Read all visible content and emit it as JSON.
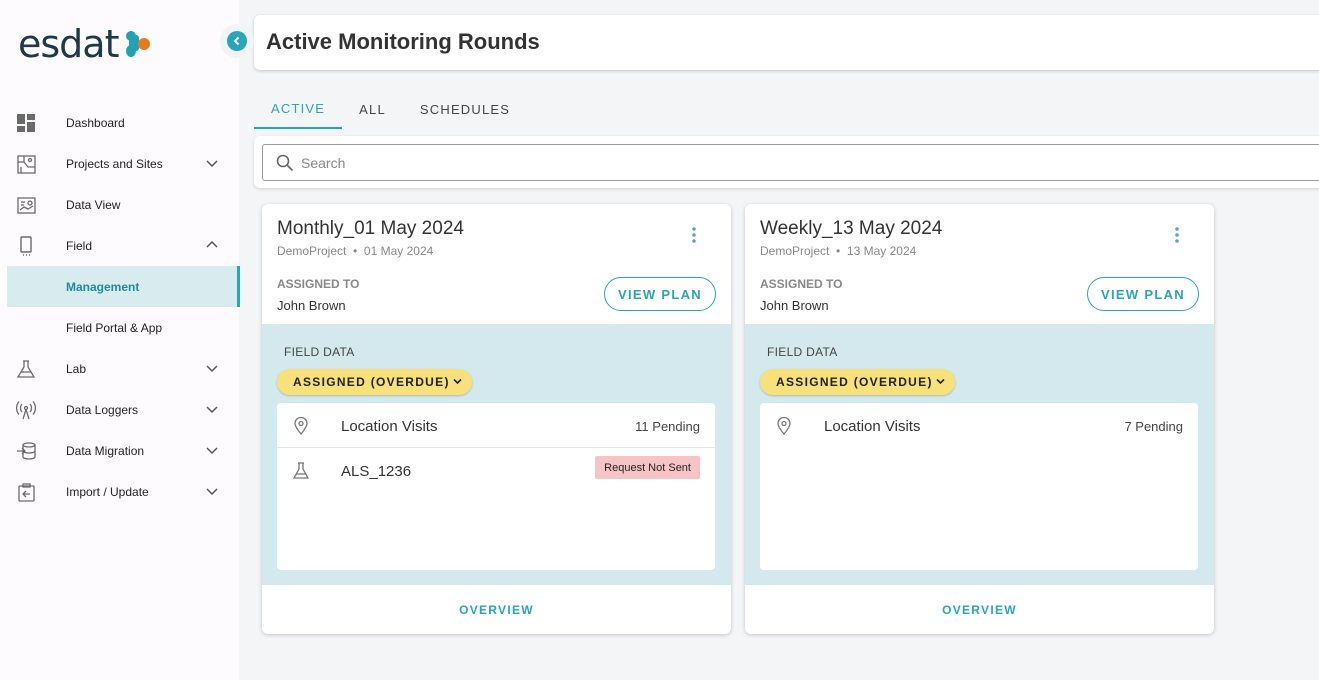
{
  "brand": {
    "logo_text": "esdat"
  },
  "sidebar": {
    "items": [
      {
        "label": "Dashboard",
        "icon": "dashboard-icon",
        "has_chevron": false
      },
      {
        "label": "Projects and Sites",
        "icon": "map-icon",
        "has_chevron": true,
        "chevron": "down"
      },
      {
        "label": "Data View",
        "icon": "chart-icon",
        "has_chevron": false
      },
      {
        "label": "Field",
        "icon": "mobile-icon",
        "has_chevron": true,
        "chevron": "up"
      },
      {
        "label": "Management",
        "icon": "",
        "active": true
      },
      {
        "label": "Field Portal & App",
        "icon": ""
      },
      {
        "label": "Lab",
        "icon": "flask-icon",
        "has_chevron": true,
        "chevron": "down"
      },
      {
        "label": "Data Loggers",
        "icon": "antenna-icon",
        "has_chevron": true,
        "chevron": "down"
      },
      {
        "label": "Data Migration",
        "icon": "database-import-icon",
        "has_chevron": true,
        "chevron": "down"
      },
      {
        "label": "Import / Update",
        "icon": "clipboard-import-icon",
        "has_chevron": true,
        "chevron": "down"
      }
    ]
  },
  "header": {
    "title": "Active Monitoring Rounds"
  },
  "tabs": [
    {
      "label": "ACTIVE",
      "active": true
    },
    {
      "label": "ALL",
      "active": false
    },
    {
      "label": "SCHEDULES",
      "active": false
    }
  ],
  "search": {
    "placeholder": "Search",
    "value": ""
  },
  "cards": [
    {
      "title": "Monthly_01 May 2024",
      "project": "DemoProject",
      "date": "01 May 2024",
      "assigned_label": "ASSIGNED TO",
      "assigned_name": "John Brown",
      "view_plan": "VIEW PLAN",
      "field_data_label": "FIELD DATA",
      "status": "ASSIGNED (OVERDUE)",
      "rows": [
        {
          "label": "Location Visits",
          "value": "11 Pending",
          "icon": "location-pin-icon",
          "type": "text"
        },
        {
          "label": "ALS_1236",
          "value": "Request Not Sent",
          "icon": "flask-icon",
          "type": "badge"
        }
      ],
      "overview": "OVERVIEW"
    },
    {
      "title": "Weekly_13 May 2024",
      "project": "DemoProject",
      "date": "13 May 2024",
      "assigned_label": "ASSIGNED TO",
      "assigned_name": "John Brown",
      "view_plan": "VIEW PLAN",
      "field_data_label": "FIELD DATA",
      "status": "ASSIGNED (OVERDUE)",
      "rows": [
        {
          "label": "Location Visits",
          "value": "7 Pending",
          "icon": "location-pin-icon",
          "type": "text"
        }
      ],
      "overview": "OVERVIEW"
    }
  ],
  "colors": {
    "accent": "#2aa5b5",
    "status_overdue": "#f8e17a",
    "badge_error": "#f6c4c6",
    "field_bg": "#d3e9ee",
    "brand_dark": "#1d3a4a",
    "brand_orange": "#e67a1f"
  }
}
